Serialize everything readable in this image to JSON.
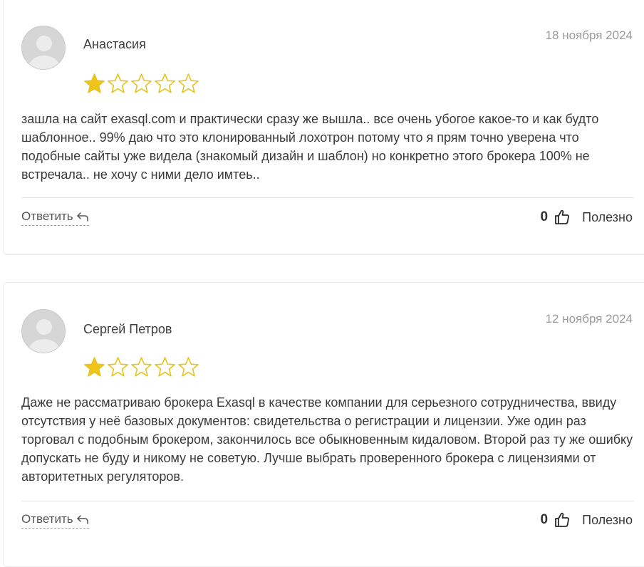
{
  "colors": {
    "star_filled": "#f0c419",
    "star_outline": "#e6c31e",
    "date": "#9a9a9a",
    "text": "#3a3a3a"
  },
  "reviews": [
    {
      "author": "Анастасия",
      "date": "18 ноября 2024",
      "rating": 1,
      "max_rating": 5,
      "text": "зашла на сайт exasql.com и практически сразу же вышла.. все очень убогое какое-то и как будто шаблонное.. 99% даю что это клонированный лохотрон потому что я прям точно уверена что подобные сайты уже видела (знакомый дизайн и шаблон) но конкретно этого брокера 100% не встречала.. не хочу с ними дело имтеь..",
      "reply_label": "Ответить",
      "reply_icon": "reply-arrow-icon",
      "helpful_count": "0",
      "helpful_icon": "thumbs-up-icon",
      "helpful_label": "Полезно"
    },
    {
      "author": "Сергей Петров",
      "date": "12 ноября 2024",
      "rating": 1,
      "max_rating": 5,
      "text": "Даже не рассматриваю брокера Exasql в качестве компании для серьезного сотрудничества, ввиду отсутствия у неё базовых документов: свидетельства о регистрации и лицензии. Уже один раз торговал с подобным брокером, закончилось все обыкновенным кидаловом. Второй раз ту же ошибку допускать не буду и никому не советую. Лучше выбрать проверенного брокера с лицензиями от авторитетных регуляторов.",
      "reply_label": "Ответить",
      "reply_icon": "reply-arrow-icon",
      "helpful_count": "0",
      "helpful_icon": "thumbs-up-icon",
      "helpful_label": "Полезно"
    }
  ]
}
